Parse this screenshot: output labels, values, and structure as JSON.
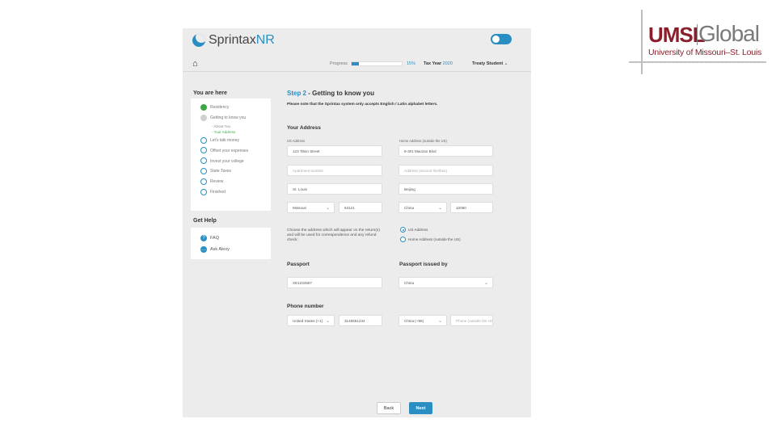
{
  "brand": {
    "umsl_word": "UMSL",
    "umsl_global": "Global",
    "umsl_sub": "University of Missouri–St. Louis",
    "app_name_prefix": "Sprintax",
    "app_name_suffix": "NR"
  },
  "topnav": {
    "progress_label": "Progress",
    "progress_percent": "15%",
    "progress_value": 0.15,
    "tax_year_label": "Tax Year",
    "tax_year_value": "2020",
    "user_name": "Treaty Student"
  },
  "sidebar": {
    "heading": "You are here",
    "steps": [
      {
        "label": "Residency",
        "status": "done"
      },
      {
        "label": "Getting to know you",
        "status": "current"
      },
      {
        "label": "Let's talk money",
        "status": "todo"
      },
      {
        "label": "Offset your expenses",
        "status": "todo"
      },
      {
        "label": "Invest your college",
        "status": "todo"
      },
      {
        "label": "State Taxes",
        "status": "todo"
      },
      {
        "label": "Review",
        "status": "todo"
      },
      {
        "label": "Finished",
        "status": "todo"
      }
    ],
    "substeps": [
      {
        "label": "- About You"
      },
      {
        "label": "- Your Address"
      }
    ],
    "help_heading": "Get Help",
    "help_items": [
      {
        "label": "FAQ",
        "icon": "?"
      },
      {
        "label": "Ask Alexy",
        "icon": "…"
      }
    ]
  },
  "form": {
    "step_number": "Step 2",
    "step_title": "- Getting to know you",
    "note": "Please note that the Sprintax system only accepts English / Latin alphabet letters.",
    "address_heading": "Your Address",
    "us_address_label": "US Address",
    "home_address_label": "Home Address (outside the US)",
    "us_street": "123 Tilton Street",
    "us_apartment_placeholder": "Apartment number",
    "us_city": "St. Louis",
    "us_state": "Missouri",
    "us_zip": "63121",
    "home_street": "8-301 Maozao Blvd",
    "home_address2_placeholder": "Address (second line/box)",
    "home_city": "Beijing",
    "home_country": "China",
    "home_zip": "10080",
    "choose_text": "Choose the address which will appear on the return(s) and will be used for correspondence and any refund check:",
    "radio_us": "US Address",
    "radio_home": "Home Address (outside the US)",
    "passport_heading": "Passport",
    "passport_number": "XE1234567",
    "passport_issued_heading": "Passport issued by",
    "passport_country": "China",
    "phone_heading": "Phone number",
    "phone_country_us": "United States (+1)",
    "phone_number_us": "3145551234",
    "phone_country_home": "China (+86)",
    "phone_number_home_placeholder": "Phone (outside the US)"
  },
  "buttons": {
    "back": "Back",
    "next": "Next"
  },
  "colors": {
    "accent": "#2a8ec2",
    "success": "#3aa845",
    "umsl_red": "#8a1e2b"
  }
}
